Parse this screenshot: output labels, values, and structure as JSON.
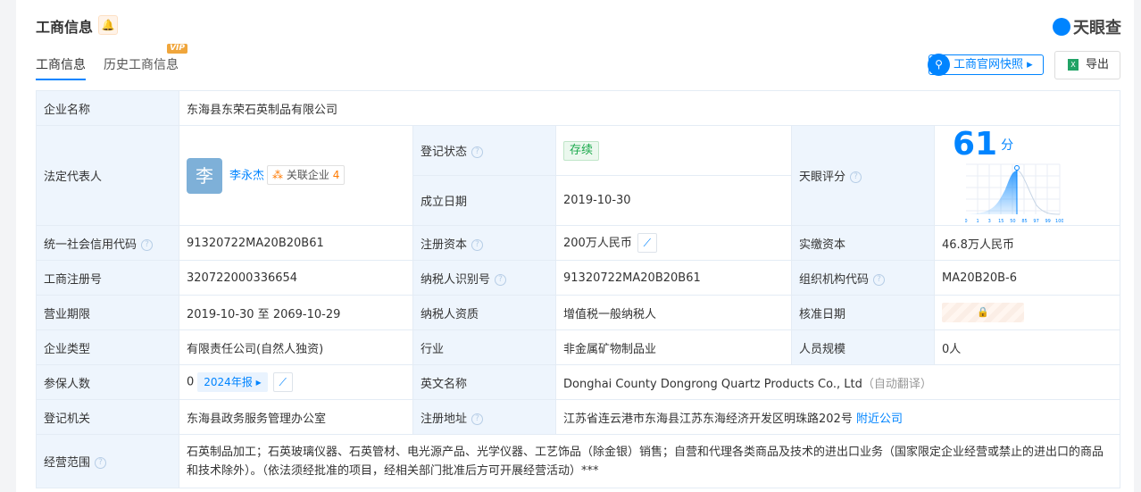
{
  "header": {
    "title": "工商信息",
    "logo_text": "天眼查",
    "snapshot_label": "工商官网快照",
    "export_label": "导出"
  },
  "tabs": [
    {
      "label": "工商信息"
    },
    {
      "label": "历史工商信息",
      "badge": "VIP"
    }
  ],
  "rows": {
    "company_name": {
      "label": "企业名称",
      "value": "东海县东荣石英制品有限公司"
    },
    "legal_rep": {
      "label": "法定代表人",
      "avatar": "李",
      "name": "李永杰",
      "related_label": "关联企业",
      "related_count": "4"
    },
    "reg_status": {
      "label": "登记状态",
      "value": "存续"
    },
    "found_date": {
      "label": "成立日期",
      "value": "2019-10-30"
    },
    "score": {
      "label": "天眼评分",
      "value": "61",
      "unit": "分"
    },
    "credit_code": {
      "label": "统一社会信用代码",
      "value": "91320722MA20B20B61"
    },
    "reg_capital": {
      "label": "注册资本",
      "value": "200万人民币"
    },
    "paid_capital": {
      "label": "实缴资本",
      "value": "46.8万人民币"
    },
    "reg_no": {
      "label": "工商注册号",
      "value": "320722000336654"
    },
    "taxpayer_id": {
      "label": "纳税人识别号",
      "value": "91320722MA20B20B61"
    },
    "org_code": {
      "label": "组织机构代码",
      "value": "MA20B20B-6"
    },
    "term": {
      "label": "营业期限",
      "value": "2019-10-30 至 2069-10-29"
    },
    "tax_qual": {
      "label": "纳税人资质",
      "value": "增值税一般纳税人"
    },
    "approve_date": {
      "label": "核准日期"
    },
    "type": {
      "label": "企业类型",
      "value": "有限责任公司(自然人独资)"
    },
    "industry": {
      "label": "行业",
      "value": "非金属矿物制品业"
    },
    "staff": {
      "label": "人员规模",
      "value": "0人"
    },
    "insured": {
      "label": "参保人数",
      "value": "0",
      "report": "2024年报"
    },
    "en_name": {
      "label": "英文名称",
      "value": "Donghai County Dongrong Quartz Products Co., Ltd",
      "note": "（自动翻译）"
    },
    "authority": {
      "label": "登记机关",
      "value": "东海县政务服务管理办公室"
    },
    "address": {
      "label": "注册地址",
      "value": "江苏省连云港市东海县江苏东海经济开发区明珠路202号",
      "link": "附近公司"
    },
    "scope": {
      "label": "经营范围",
      "value": "石英制品加工；石英玻璃仪器、石英管材、电光源产品、光学仪器、工艺饰品（除金银）销售；自营和代理各类商品及技术的进出口业务（国家限定企业经营或禁止的进出口的商品和技术除外）。（依法须经批准的项目，经相关部门批准后方可开展经营活动）***"
    }
  },
  "score_chart": {
    "ticks": [
      "0",
      "1",
      "3",
      "15",
      "50",
      "85",
      "97",
      "99",
      "100"
    ],
    "marker_percentile": 61,
    "accent": "#0084ff"
  }
}
